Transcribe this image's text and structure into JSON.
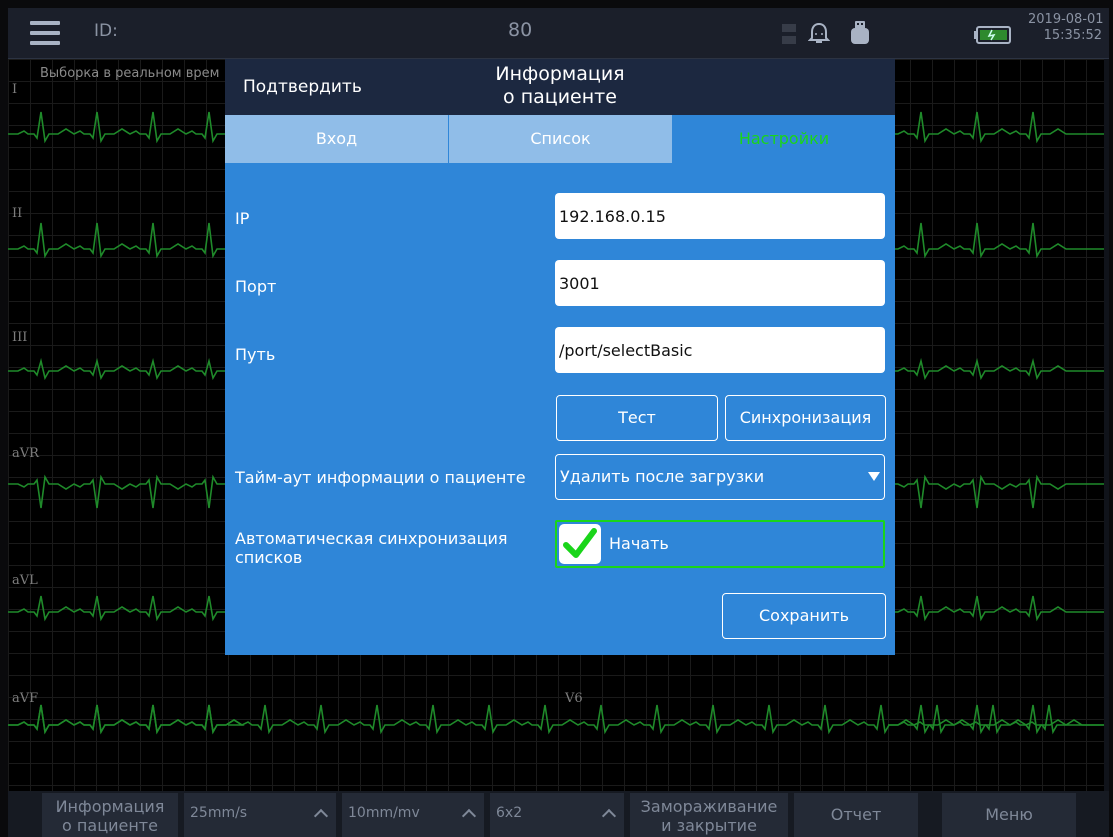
{
  "topbar": {
    "id_label": "ID:",
    "heart_rate": "80",
    "date": "2019-08-01",
    "time": "15:35:52"
  },
  "ecg": {
    "realtime_label": "Выборка в реальном врем",
    "leads_left": [
      "I",
      "II",
      "III",
      "aVR",
      "aVL",
      "aVF"
    ],
    "lead_v6": "V6",
    "trace_color": "#1f8a2a"
  },
  "dialog": {
    "confirm_label": "Подтвердить",
    "title_line1": "Информация",
    "title_line2": "о пациенте",
    "tabs": [
      {
        "label": "Вход",
        "active": false
      },
      {
        "label": "Список",
        "active": false
      },
      {
        "label": "Настройки",
        "active": true
      }
    ],
    "ip": {
      "label": "IP",
      "value": "192.168.0.15"
    },
    "port": {
      "label": "Порт",
      "value": "3001"
    },
    "path": {
      "label": "Путь",
      "value": "/port/selectBasic"
    },
    "test_label": "Тест",
    "sync_label": "Синхронизация",
    "timeout": {
      "label": "Тайм-аут информации о пациенте",
      "value": "Удалить после загрузки"
    },
    "auto_sync": {
      "label_line1": "Автоматическая синхронизация",
      "label_line2": "списков",
      "checked": true,
      "checkbox_label": "Начать"
    },
    "save_label": "Сохранить",
    "colors": {
      "panel": "#2f86d8",
      "header": "#1c2840",
      "active_tab_text": "#1ad51a"
    }
  },
  "bottombar": {
    "patient_info_line1": "Информация",
    "patient_info_line2": "о пациенте",
    "speed": "25mm/s",
    "gain": "10mm/mv",
    "layout": "6x2",
    "freeze_line1": "Замораживание",
    "freeze_line2": "и закрытие",
    "report": "Отчет",
    "menu": "Меню"
  }
}
